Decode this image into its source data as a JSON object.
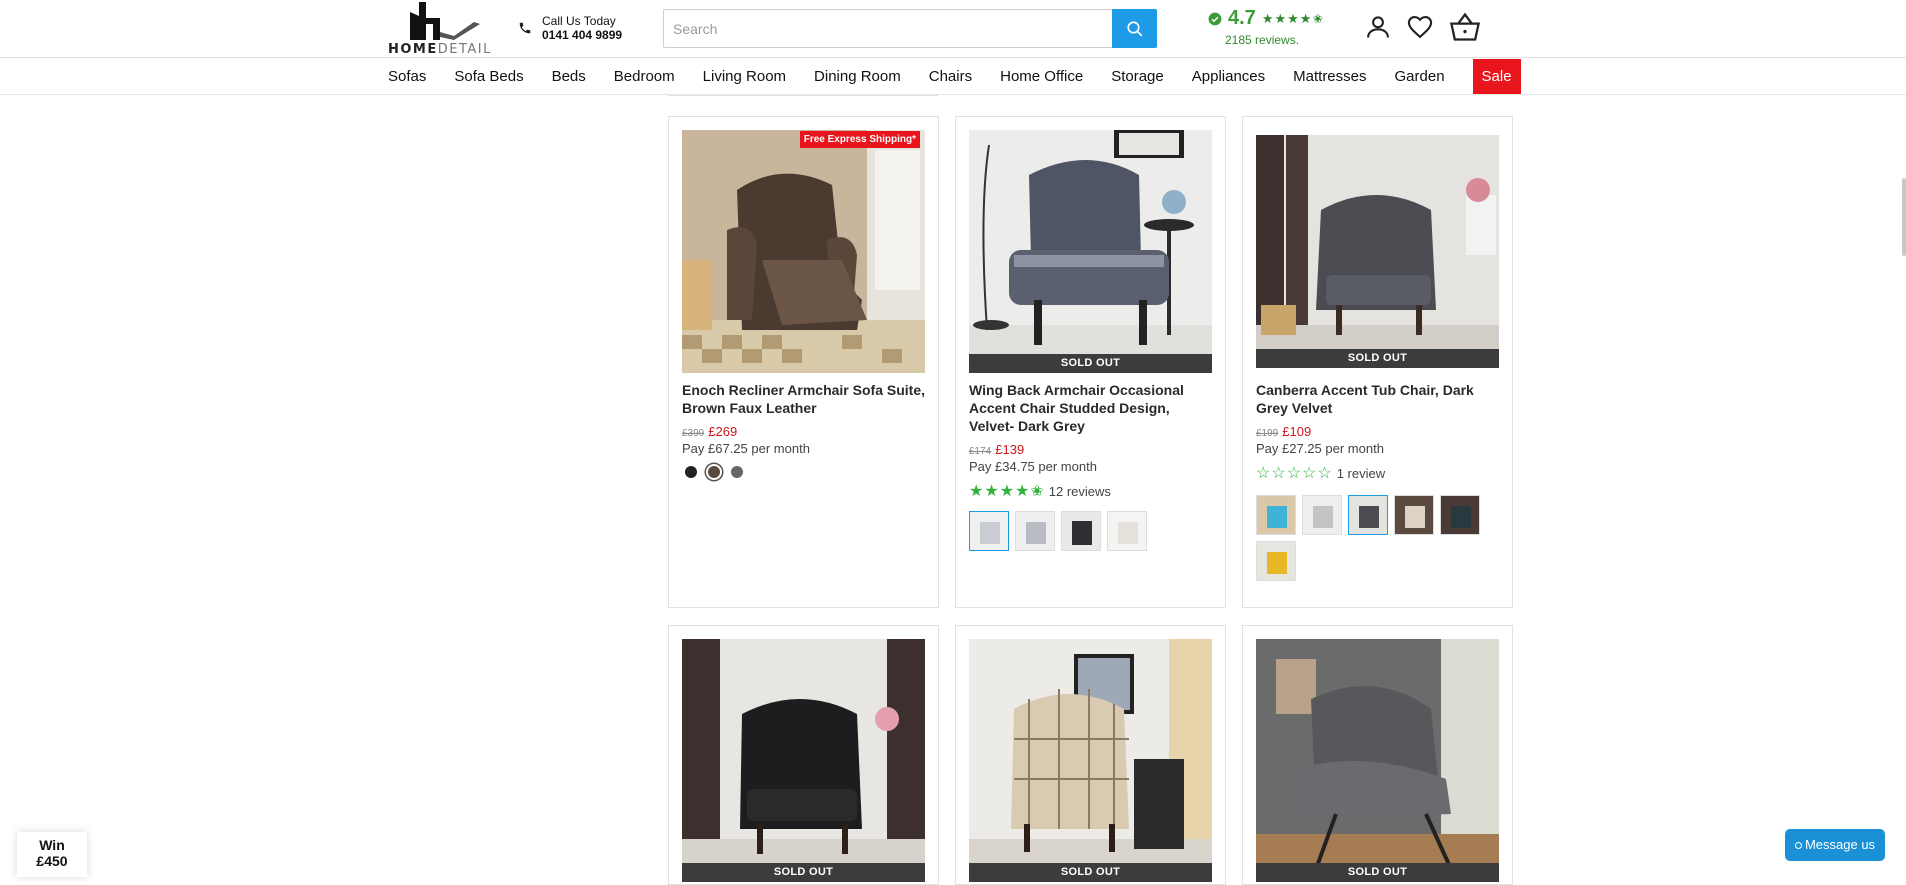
{
  "header": {
    "logo_home": "HOME",
    "logo_detail": "DETAIL",
    "call_title": "Call Us Today",
    "call_number": "0141 404 9899",
    "search_placeholder": "Search",
    "rating_score": "4.7",
    "rating_stars": "★★★★✬",
    "rating_reviews": "2185 reviews."
  },
  "nav": {
    "items": [
      "Sofas",
      "Sofa Beds",
      "Beds",
      "Bedroom",
      "Living Room",
      "Dining Room",
      "Chairs",
      "Home Office",
      "Storage",
      "Appliances",
      "Mattresses",
      "Garden",
      "Sale"
    ]
  },
  "products": [
    {
      "badge": "Free Express Shipping*",
      "title": "Enoch Recliner Armchair Sofa Suite, Brown Faux Leather",
      "old_price": "£399",
      "new_price": "£269",
      "pay": "Pay £67.25 per month",
      "colors": [
        "#222222",
        "#5a4a3e",
        "#666666"
      ]
    },
    {
      "soldout": "SOLD OUT",
      "title": "Wing Back Armchair Occasional Accent Chair Studded Design, Velvet- Dark Grey",
      "old_price": "£174",
      "new_price": "£139",
      "pay": "Pay £34.75 per month",
      "stars": "★★★★✬",
      "reviews": "12 reviews"
    },
    {
      "soldout": "SOLD OUT",
      "title": "Canberra Accent Tub Chair, Dark Grey Velvet",
      "old_price": "£199",
      "new_price": "£109",
      "pay": "Pay £27.25 per month",
      "stars": "☆☆☆☆☆",
      "reviews": "1 review"
    },
    {
      "soldout": "SOLD OUT"
    },
    {
      "soldout": "SOLD OUT"
    },
    {
      "soldout": "SOLD OUT"
    }
  ],
  "widgets": {
    "win_line1": "Win",
    "win_line2": "£450",
    "message": "Message us"
  }
}
